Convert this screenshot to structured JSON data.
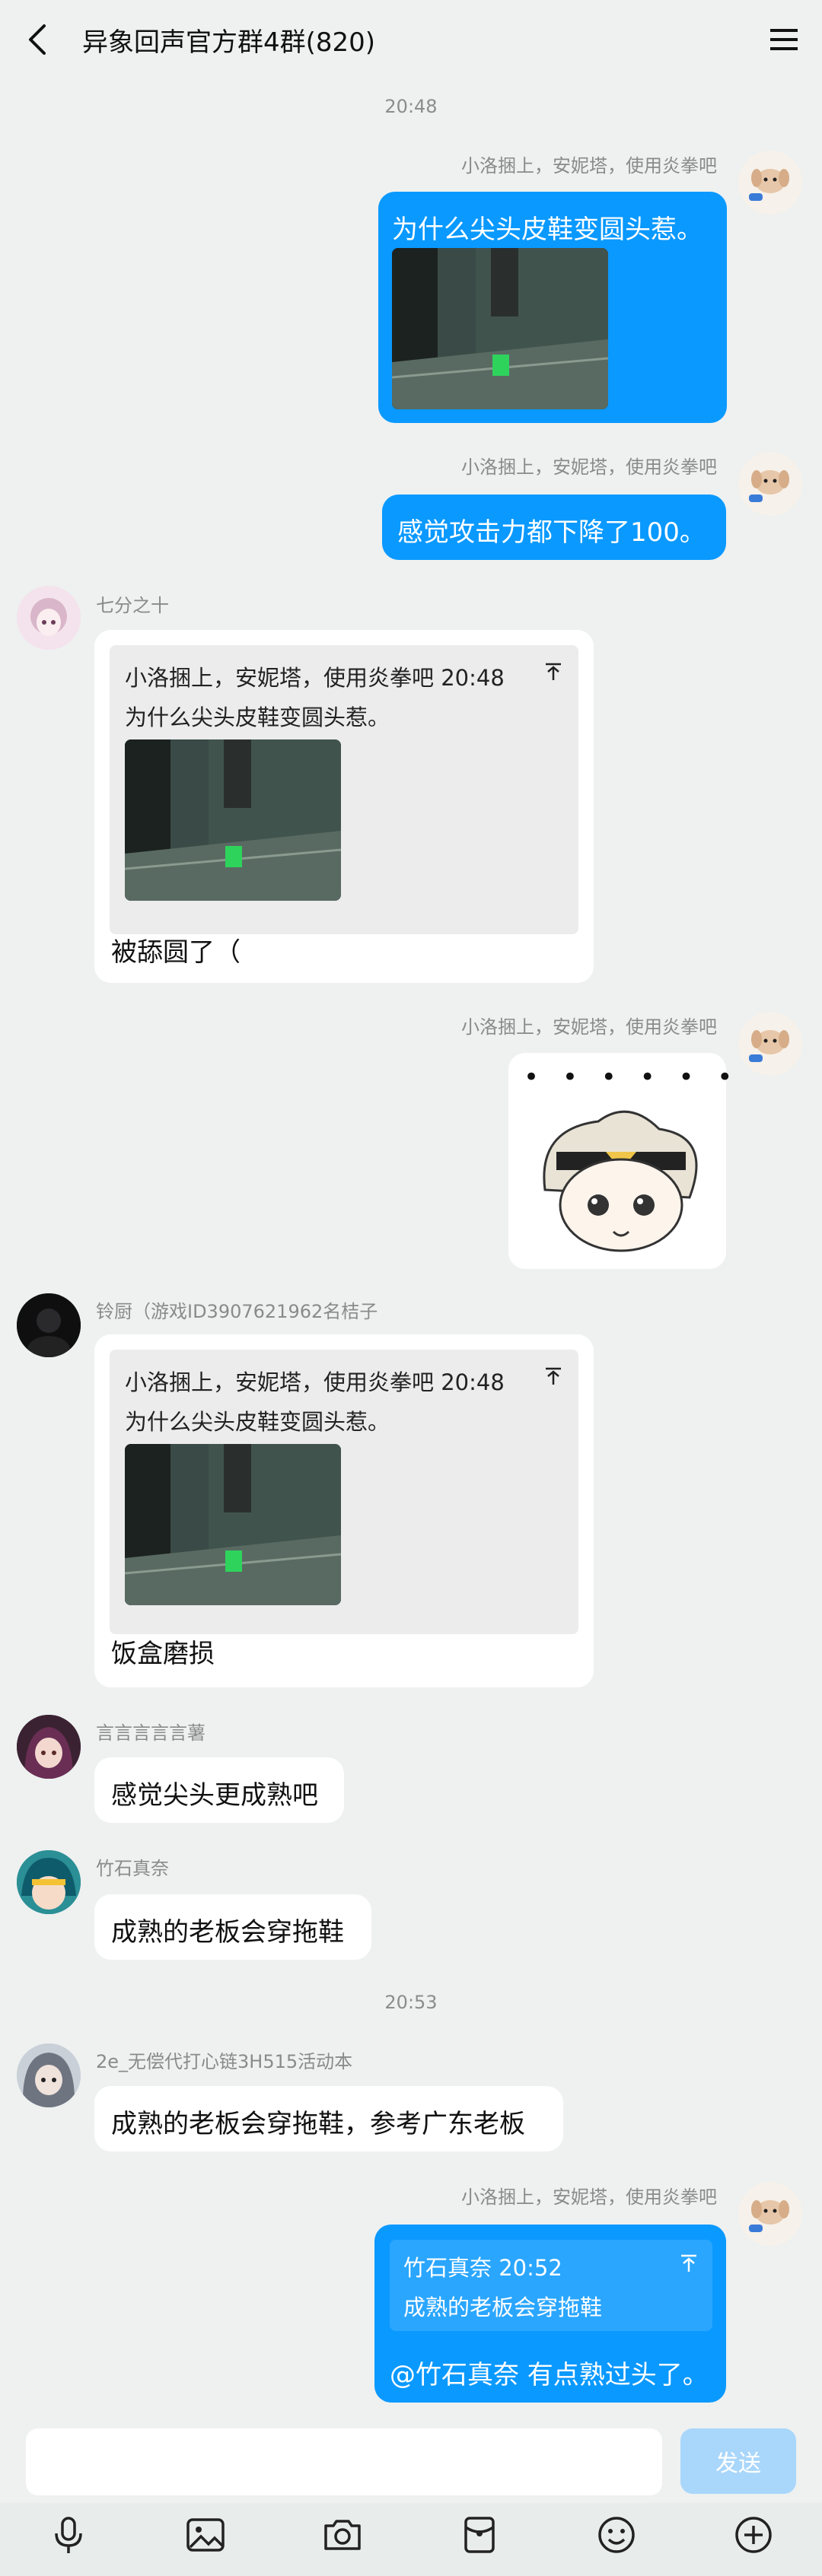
{
  "header": {
    "title": "异象回声官方群4群(820)",
    "back_icon": "chevron-left-icon",
    "menu_icon": "hamburger-menu-icon"
  },
  "colors": {
    "accent_blue": "#0a99ff",
    "background": "#eef1f0",
    "send_disabled": "#a9d6fb"
  },
  "timestamps": [
    "20:48",
    "20:53"
  ],
  "messages": [
    {
      "nick": "小洛捆上，安妮塔，使用炎拳吧",
      "text": "为什么尖头皮鞋变圆头惹。"
    },
    {
      "nick": "小洛捆上，安妮塔，使用炎拳吧",
      "text": "感觉攻击力都下降了100。"
    },
    {
      "nick": "七分之十",
      "quote_header": "小洛捆上，安妮塔，使用炎拳吧 20:48",
      "quote_text": "为什么尖头皮鞋变圆头惹。",
      "text": "被舔圆了（"
    },
    {
      "nick": "小洛捆上，安妮塔，使用炎拳吧",
      "sticker_dots": "• • • • • •"
    },
    {
      "nick": "铃厨（游戏ID3907621962名桔子",
      "quote_header": "小洛捆上，安妮塔，使用炎拳吧 20:48",
      "quote_text": "为什么尖头皮鞋变圆头惹。",
      "text": "饭盒磨损"
    },
    {
      "nick": "言言言言言薯",
      "text": "感觉尖头更成熟吧"
    },
    {
      "nick": "竹石真奈",
      "text": "成熟的老板会穿拖鞋"
    },
    {
      "nick": "2e_无偿代打心链3H515活动本",
      "text": "成熟的老板会穿拖鞋，参考广东老板"
    },
    {
      "nick": "小洛捆上，安妮塔，使用炎拳吧",
      "quote_header": "竹石真奈 20:52",
      "quote_text": "成熟的老板会穿拖鞋",
      "text": "@竹石真奈 有点熟过头了。"
    }
  ],
  "input": {
    "placeholder": "",
    "send_label": "发送"
  },
  "toolbar": [
    "microphone-icon",
    "image-icon",
    "camera-icon",
    "red-packet-icon",
    "emoji-icon",
    "plus-icon"
  ]
}
